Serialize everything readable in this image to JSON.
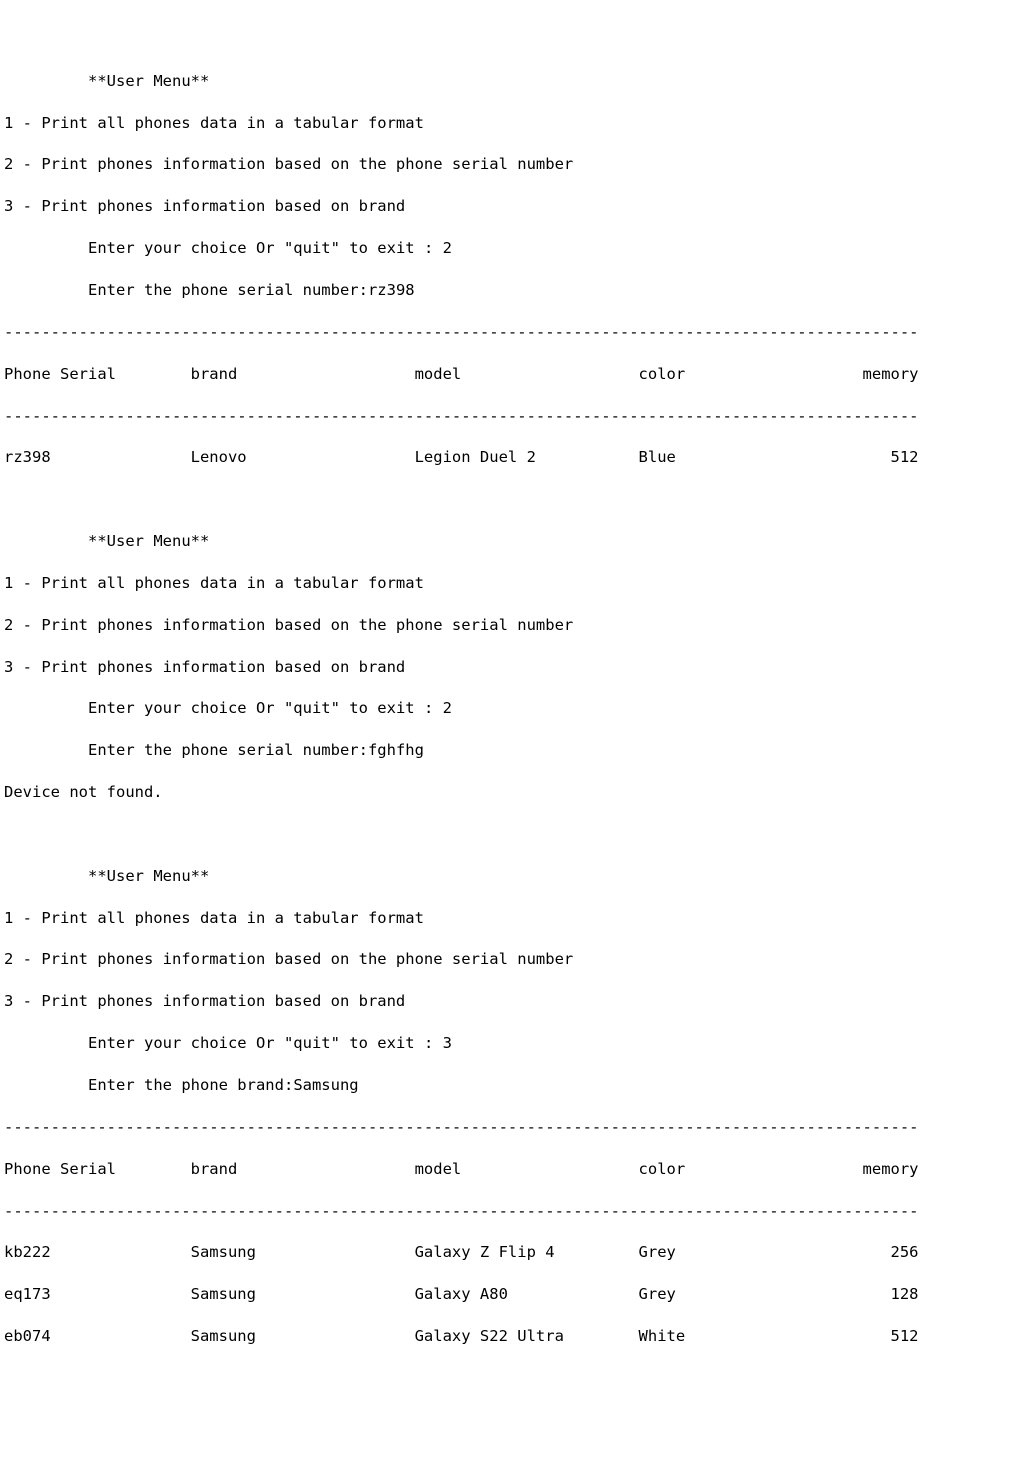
{
  "menu": {
    "title": "**User Menu**",
    "options": [
      "1 - Print all phones data in a tabular format",
      "2 - Print phones information based on the phone serial number",
      "3 - Print phones information based on brand"
    ],
    "choice_prompt": "Enter your choice Or \"quit\" to exit : ",
    "serial_prompt": "Enter the phone serial number:",
    "brand_prompt": "Enter the phone brand:"
  },
  "headers": {
    "serial": "Phone Serial",
    "brand": "brand",
    "model": "model",
    "color": "color",
    "memory": "memory"
  },
  "not_found": "Device not found.",
  "session1": {
    "choice": "2",
    "serial_input": "rz398",
    "row": {
      "serial": "rz398",
      "brand": "Lenovo",
      "model": "Legion Duel 2",
      "color": "Blue",
      "memory": "512"
    }
  },
  "session2": {
    "choice": "2",
    "serial_input": "fghfhg"
  },
  "session3": {
    "choice": "3",
    "brand_input": "Samsung",
    "rows": [
      {
        "serial": "kb222",
        "brand": "Samsung",
        "model": "Galaxy Z Flip 4",
        "color": "Grey",
        "memory": "256"
      },
      {
        "serial": "eq173",
        "brand": "Samsung",
        "model": "Galaxy A80",
        "color": "Grey",
        "memory": "128"
      },
      {
        "serial": "eb074",
        "brand": "Samsung",
        "model": "Galaxy S22 Ultra",
        "color": "White",
        "memory": "512"
      }
    ]
  },
  "dashes": "--------------------------------------------------------------------------------------------------"
}
